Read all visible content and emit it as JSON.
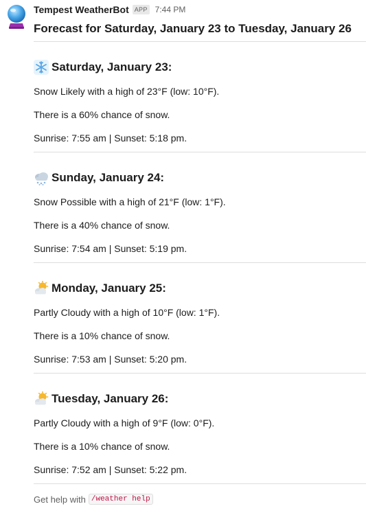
{
  "message": {
    "bot_name": "Tempest WeatherBot",
    "badge": "APP",
    "time": "7:44 PM",
    "title": "Forecast for Saturday, January 23 to Tuesday, January 26",
    "avatar_icon": "crystal-ball-icon"
  },
  "days": [
    {
      "icon": "snowflake-icon",
      "heading": "Saturday, January 23:",
      "summary": "Snow Likely with a high of 23°F (low: 10°F).",
      "chance": "There is a 60% chance of snow.",
      "sun": "Sunrise: 7:55 am | Sunset: 5:18 pm."
    },
    {
      "icon": "snow-cloud-icon",
      "heading": "Sunday, January 24:",
      "summary": "Snow Possible with a high of 21°F (low: 1°F).",
      "chance": "There is a 40% chance of snow.",
      "sun": "Sunrise: 7:54 am | Sunset: 5:19 pm."
    },
    {
      "icon": "partly-cloudy-icon",
      "heading": "Monday, January 25:",
      "summary": "Partly Cloudy with a high of 10°F (low: 1°F).",
      "chance": "There is a 10% chance of snow.",
      "sun": "Sunrise: 7:53 am | Sunset: 5:20 pm."
    },
    {
      "icon": "partly-cloudy-icon",
      "heading": "Tuesday, January 26:",
      "summary": "Partly Cloudy with a high of 9°F (low: 0°F).",
      "chance": "There is a 10% chance of snow.",
      "sun": "Sunrise: 7:52 am | Sunset: 5:22 pm."
    }
  ],
  "footer": {
    "text": "Get help with",
    "command": "/weather help"
  },
  "colors": {
    "command_text": "#c01343",
    "muted_text": "#616061",
    "divider": "#dddddd"
  }
}
